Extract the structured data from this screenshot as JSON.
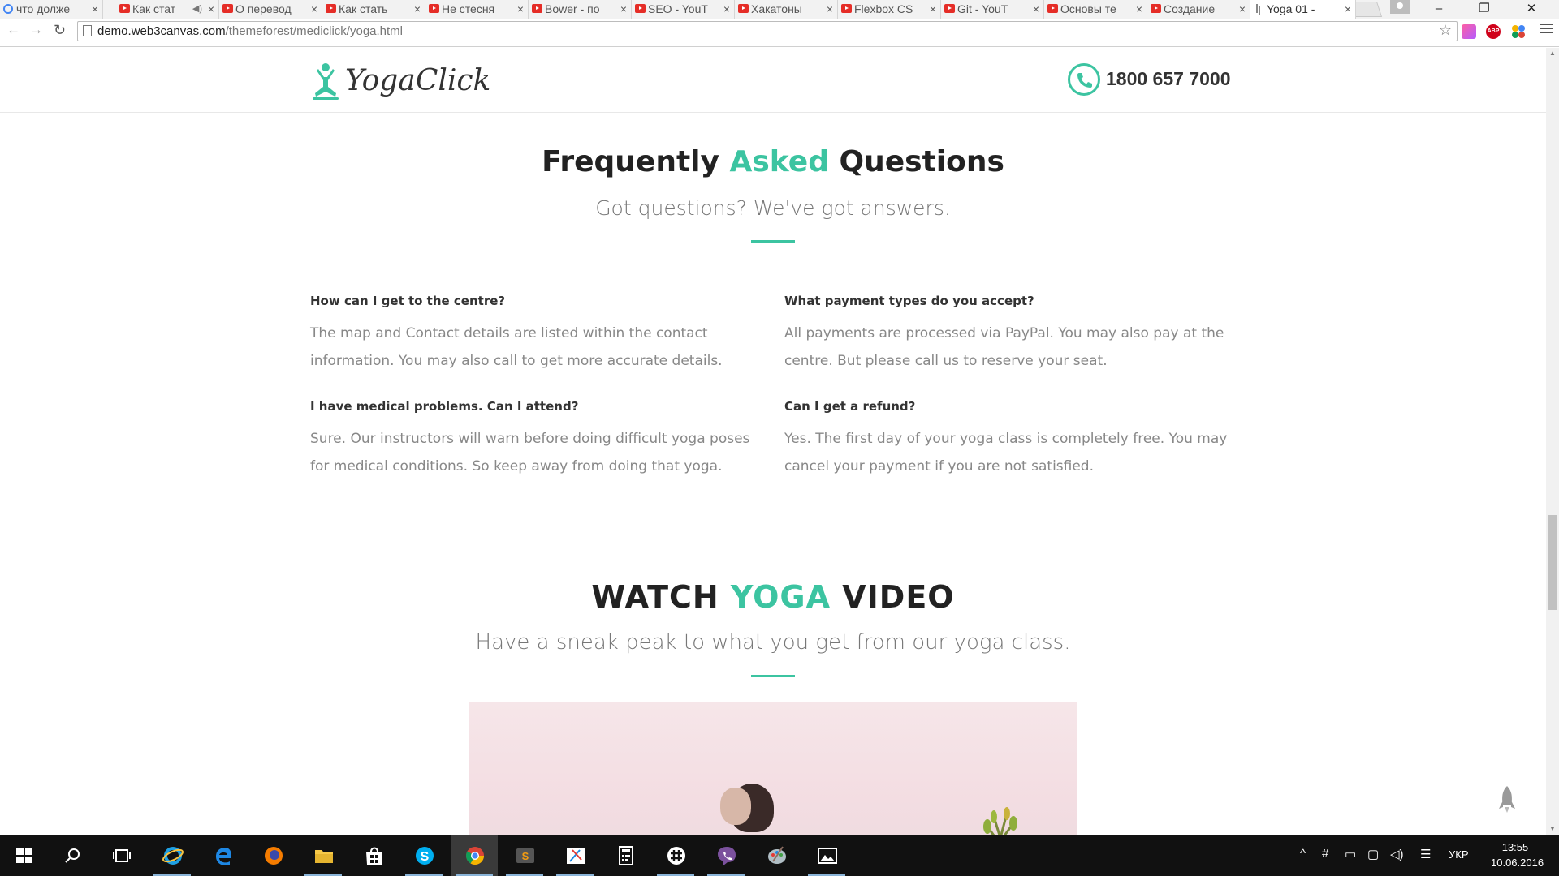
{
  "browser": {
    "tabs": [
      {
        "label": "что долже",
        "favicon": "google-icon"
      },
      {
        "label": "Как стат",
        "favicon": "youtube-icon",
        "audio": true
      },
      {
        "label": "О перевод",
        "favicon": "youtube-icon"
      },
      {
        "label": "Как стать",
        "favicon": "youtube-icon"
      },
      {
        "label": "Не стесня",
        "favicon": "youtube-icon"
      },
      {
        "label": "Bower - по",
        "favicon": "youtube-icon"
      },
      {
        "label": "SEO - YouT",
        "favicon": "youtube-icon"
      },
      {
        "label": "Хакатоны",
        "favicon": "youtube-icon"
      },
      {
        "label": "Flexbox CS",
        "favicon": "youtube-icon"
      },
      {
        "label": "Git - YouT",
        "favicon": "youtube-icon"
      },
      {
        "label": "Основы те",
        "favicon": "youtube-icon"
      },
      {
        "label": "Создание",
        "favicon": "youtube-icon"
      },
      {
        "label": "Yoga 01 -",
        "favicon": "yoga-icon",
        "active": true
      }
    ],
    "url_host": "demo.web3canvas.com",
    "url_path": "/themeforest/mediclick/yoga.html",
    "extensions": [
      "color-picker-icon",
      "adblock-plus-icon",
      "plugin-icon"
    ],
    "abp_label": "ABP"
  },
  "site": {
    "brand": "YogaClick",
    "phone": "1800 657 7000",
    "accent_color": "#3cc4a1"
  },
  "faq_section": {
    "title_pre": "Frequently ",
    "title_accent": "Asked",
    "title_post": " Questions",
    "subtitle": "Got questions? We've got answers.",
    "items": [
      {
        "question": "How can I get to the centre?",
        "answer": "The map and Contact details are listed within the contact information. You may also call to get more accurate details."
      },
      {
        "question": "What payment types do you accept?",
        "answer": "All payments are processed via PayPal. You may also pay at the centre. But please call us to reserve your seat."
      },
      {
        "question": "I have medical problems. Can I attend?",
        "answer": "Sure. Our instructors will warn before doing difficult yoga poses for medical conditions. So keep away from doing that yoga."
      },
      {
        "question": "Can I get a refund?",
        "answer": "Yes. The first day of your yoga class is completely free. You may cancel your payment if you are not satisfied."
      }
    ]
  },
  "video_section": {
    "title_pre": "WATCH ",
    "title_accent": "YOGA",
    "title_post": " VIDEO",
    "subtitle": "Have a sneak peak to what you get from our yoga class."
  },
  "taskbar": {
    "apps": [
      "windows-start-icon",
      "search-icon",
      "task-view-icon",
      "internet-explorer-icon",
      "edge-icon",
      "firefox-icon",
      "file-explorer-icon",
      "store-icon",
      "skype-icon",
      "chrome-icon",
      "sublime-text-icon",
      "snipping-icon",
      "calculator-icon",
      "slack-icon",
      "viber-icon",
      "paint-icon",
      "photos-icon"
    ],
    "language": "УКР",
    "time": "13:55",
    "date": "10.06.2016"
  }
}
